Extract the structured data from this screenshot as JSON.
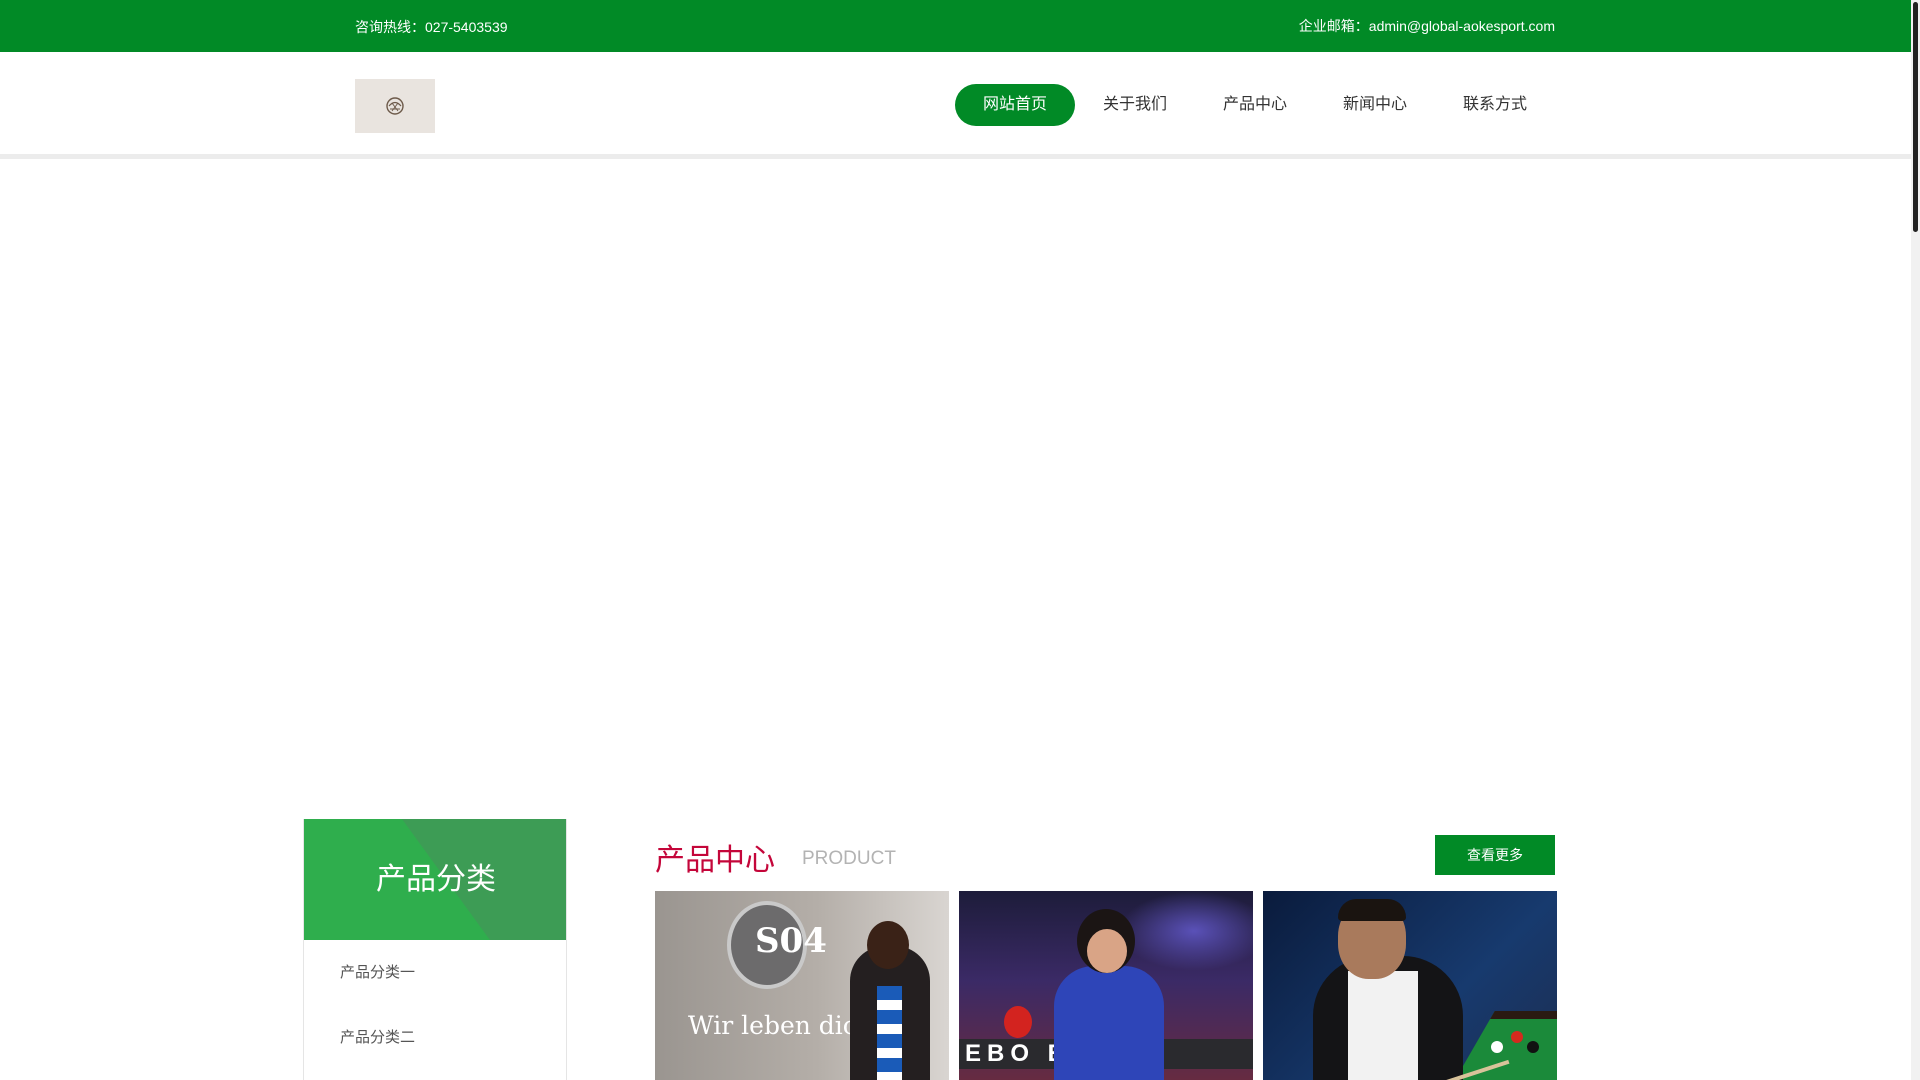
{
  "topbar": {
    "hotline": "咨询热线：027-5403539",
    "email": "企业邮箱：admin@global-aokesport.com"
  },
  "logo": {
    "icon": "logo-emblem"
  },
  "nav": {
    "items": [
      {
        "label": "网站首页",
        "active": true
      },
      {
        "label": "关于我们",
        "active": false
      },
      {
        "label": "产品中心",
        "active": false
      },
      {
        "label": "新闻中心",
        "active": false
      },
      {
        "label": "联系方式",
        "active": false
      }
    ]
  },
  "sidebar": {
    "title": "产品分类",
    "items": [
      {
        "label": "产品分类一"
      },
      {
        "label": "产品分类二"
      }
    ]
  },
  "products_section": {
    "title": "产品中心",
    "subtitle": "PRODUCT",
    "more_label": "查看更多",
    "items": [
      {
        "image_text": "Wir leben dich",
        "badge_text": "S04"
      },
      {
        "image_text": "EBO  ER"
      },
      {
        "image_text": ""
      }
    ]
  },
  "colors": {
    "brand_green": "#018a26",
    "sidebar_green": "#2fae4d",
    "accent_red": "#c4063a"
  }
}
